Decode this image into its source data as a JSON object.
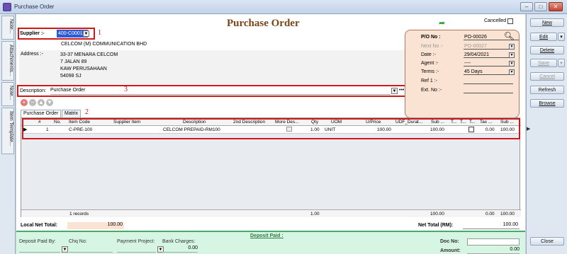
{
  "window": {
    "title": "Purchase Order"
  },
  "left_tabs": [
    "Note...",
    "Attachments...",
    "Note...",
    "Item Template..."
  ],
  "form": {
    "title": "Purchase Order",
    "supplier_label": "Supplier :-",
    "supplier_code": "400-C0001",
    "supplier_name": "CELCOM (M) COMMUNICATION BHD",
    "address_label": "Address :-",
    "address_lines": [
      "33-37 MENARA CELCOM",
      "7 JALAN 89",
      "KAW PERUSAHAAN",
      "54098 SJ"
    ],
    "description_label": "Description:",
    "description_value": "Purchase Order",
    "annotations": [
      "1",
      "2",
      "3"
    ]
  },
  "header_panel": {
    "cancelled_label": "Cancelled",
    "po_no_label": "P/O No :",
    "po_no": "PO-00026",
    "next_no_label": "Next No :-",
    "next_no": "PO-00027",
    "date_label": "Date :-",
    "date": "29/04/2021",
    "agent_label": "Agent :-",
    "agent": "----",
    "terms_label": "Terms :-",
    "terms": "45 Days",
    "ref1_label": "Ref 1 :-",
    "ext_no_label": "Ext. No :-"
  },
  "tabs": [
    "Purchase Order",
    "Matrix"
  ],
  "grid": {
    "headers": [
      "#",
      "No.",
      "Item Code",
      "Supplier Item",
      "Description",
      "2nd Description",
      "More Des...",
      "Qty",
      "UOM",
      "U/Price",
      "UDF_Durat...",
      "Sub ...",
      "T...",
      "T...",
      "T...",
      "Tax ...",
      "Sub ..."
    ],
    "row": {
      "num": "1",
      "item_code": "C-PRE-100",
      "description": "CELCOM PREPAID-RM100",
      "qty": "1.00",
      "uom": "UNIT",
      "uprice": "100.00",
      "sub": "100.00",
      "tax": "0.00",
      "sub2": "100.00"
    },
    "footer": {
      "records": "1 records",
      "qty": "1.00",
      "sub": "100.00",
      "tax": "0.00",
      "sub2": "100.00"
    }
  },
  "totals": {
    "local_label": "Local Net Total:",
    "local_value": "100.00",
    "net_label": "Net Total (RM):",
    "net_value": "100.00"
  },
  "deposit": {
    "header": "Deposit Paid :",
    "paid_by_label": "Deposit Paid By:",
    "chq_label": "Chq No:",
    "project_label": "Payment Project:",
    "charges_label": "Bank Charges:",
    "charges_value": "0.00",
    "doc_no_label": "Doc No:",
    "amount_label": "Amount:",
    "amount_value": "0.00"
  },
  "sidebar": {
    "new": "New",
    "edit": "Edit",
    "delete": "Delete",
    "save": "Save",
    "cancel": "Cancel",
    "refresh": "Refresh",
    "browse": "Browse",
    "close": "Close"
  }
}
